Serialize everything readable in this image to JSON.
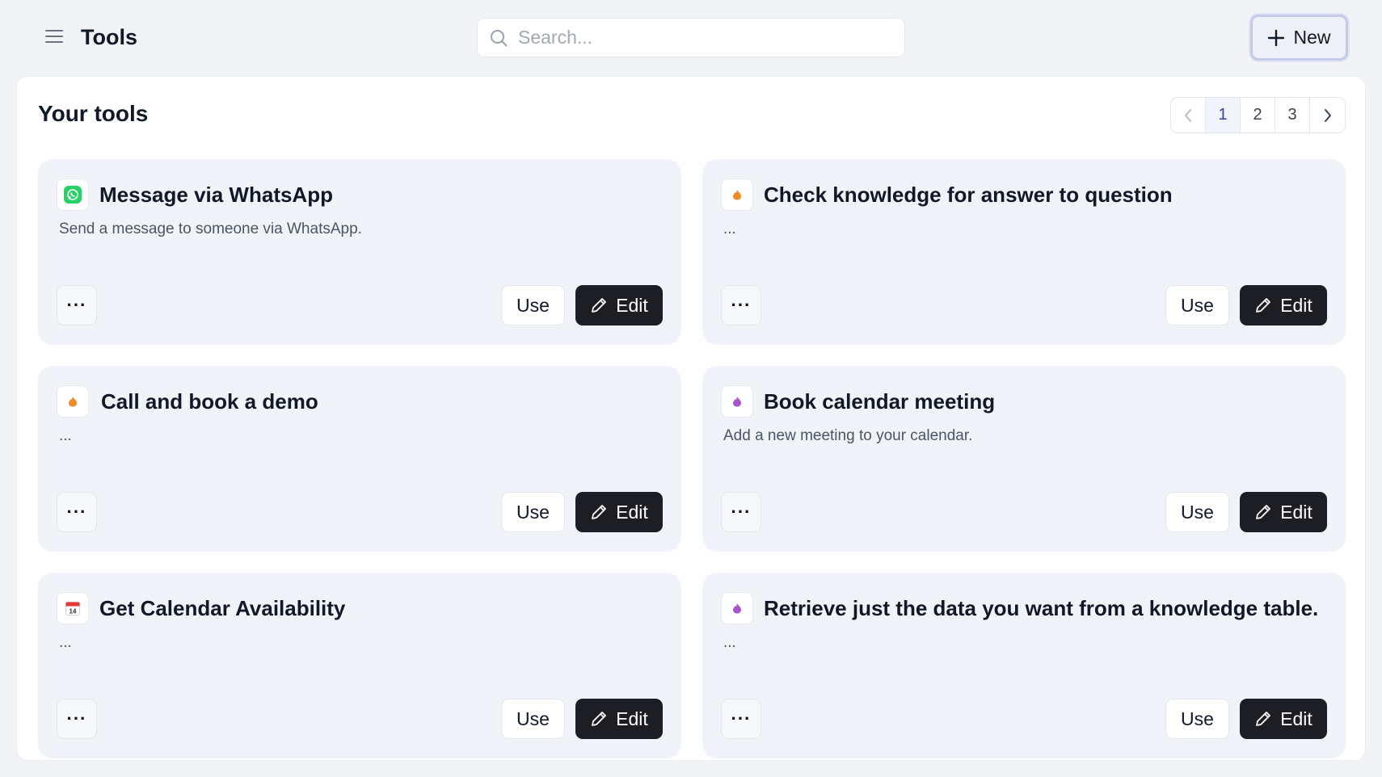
{
  "header": {
    "title": "Tools",
    "search_placeholder": "Search...",
    "new_label": "New"
  },
  "panel": {
    "title": "Your tools",
    "pagination": {
      "pages": [
        "1",
        "2",
        "3"
      ],
      "current": "1"
    }
  },
  "labels": {
    "use": "Use",
    "edit": "Edit",
    "more": "···"
  },
  "colors": {
    "whatsapp": "#25d366",
    "orange": "#f08a24",
    "purple": "#a855c7",
    "calendar_red": "#e53935",
    "edit_bg": "#1c1e24"
  },
  "tools": [
    {
      "title": "Message via WhatsApp",
      "description": "Send a message to someone via WhatsApp.",
      "icon": "whatsapp-icon"
    },
    {
      "title": "Check knowledge for answer to question",
      "description": "...",
      "icon": "orange-flame-icon"
    },
    {
      "title": "Call and book a demo",
      "description": "...",
      "icon": "orange-flame-icon"
    },
    {
      "title": "Book calendar meeting",
      "description": "Add a new meeting to your calendar.",
      "icon": "purple-flame-icon"
    },
    {
      "title": "Get Calendar Availability",
      "description": "...",
      "icon": "calendar-icon",
      "icon_text": "14"
    },
    {
      "title": "Retrieve just the data you want from a knowledge table.",
      "description": "...",
      "icon": "purple-flame-icon"
    }
  ]
}
